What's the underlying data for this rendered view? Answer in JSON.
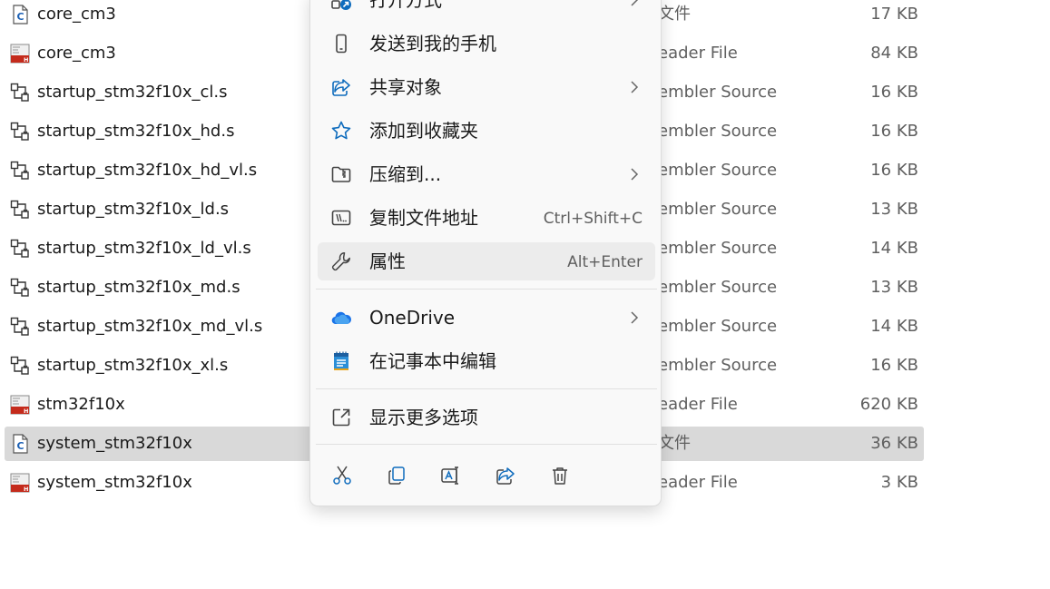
{
  "files": [
    {
      "name": "core_cm3",
      "icon": "c-source-file-icon",
      "type": "文件",
      "size": "17 KB",
      "selected": false
    },
    {
      "name": "core_cm3",
      "icon": "header-file-icon",
      "type": "eader File",
      "size": "84 KB",
      "selected": false
    },
    {
      "name": "startup_stm32f10x_cl.s",
      "icon": "assembler-source-icon",
      "type": "embler Source",
      "size": "16 KB",
      "selected": false
    },
    {
      "name": "startup_stm32f10x_hd.s",
      "icon": "assembler-source-icon",
      "type": "embler Source",
      "size": "16 KB",
      "selected": false
    },
    {
      "name": "startup_stm32f10x_hd_vl.s",
      "icon": "assembler-source-icon",
      "type": "embler Source",
      "size": "16 KB",
      "selected": false
    },
    {
      "name": "startup_stm32f10x_ld.s",
      "icon": "assembler-source-icon",
      "type": "embler Source",
      "size": "13 KB",
      "selected": false
    },
    {
      "name": "startup_stm32f10x_ld_vl.s",
      "icon": "assembler-source-icon",
      "type": "embler Source",
      "size": "14 KB",
      "selected": false
    },
    {
      "name": "startup_stm32f10x_md.s",
      "icon": "assembler-source-icon",
      "type": "embler Source",
      "size": "13 KB",
      "selected": false
    },
    {
      "name": "startup_stm32f10x_md_vl.s",
      "icon": "assembler-source-icon",
      "type": "embler Source",
      "size": "14 KB",
      "selected": false
    },
    {
      "name": "startup_stm32f10x_xl.s",
      "icon": "assembler-source-icon",
      "type": "embler Source",
      "size": "16 KB",
      "selected": false
    },
    {
      "name": "stm32f10x",
      "icon": "header-file-icon",
      "type": "eader File",
      "size": "620 KB",
      "selected": false
    },
    {
      "name": "system_stm32f10x",
      "icon": "c-source-file-icon",
      "type": "文件",
      "size": "36 KB",
      "selected": true
    },
    {
      "name": "system_stm32f10x",
      "icon": "header-file-icon",
      "type": "eader File",
      "size": "3 KB",
      "selected": false
    }
  ],
  "context_menu": {
    "items": [
      {
        "label": "打开方式",
        "icon": "open-with-icon",
        "submenu": true
      },
      {
        "label": "发送到我的手机",
        "icon": "phone-icon"
      },
      {
        "label": "共享对象",
        "icon": "share-icon",
        "submenu": true
      },
      {
        "label": "添加到收藏夹",
        "icon": "star-icon"
      },
      {
        "label": "压缩到...",
        "icon": "zip-folder-icon",
        "submenu": true
      },
      {
        "label": "复制文件地址",
        "icon": "copy-path-icon",
        "shortcut": "Ctrl+Shift+C"
      },
      {
        "label": "属性",
        "icon": "wrench-icon",
        "shortcut": "Alt+Enter",
        "hover": true
      },
      {
        "label": "OneDrive",
        "icon": "onedrive-cloud-icon",
        "submenu": true
      },
      {
        "label": "在记事本中编辑",
        "icon": "notepad-icon"
      },
      {
        "label": "显示更多选项",
        "icon": "show-more-options-icon"
      }
    ],
    "toolbar": [
      "cut-icon",
      "copy-icon",
      "rename-icon",
      "share-icon",
      "delete-icon"
    ]
  },
  "colors": {
    "accent": "#0f6cbd",
    "selection": "#d9d9d9",
    "menu_bg": "#f9f9f9",
    "menu_hover": "#ececec",
    "header_red": "#c42b1c",
    "onedrive_blue": "#1a73e8"
  }
}
